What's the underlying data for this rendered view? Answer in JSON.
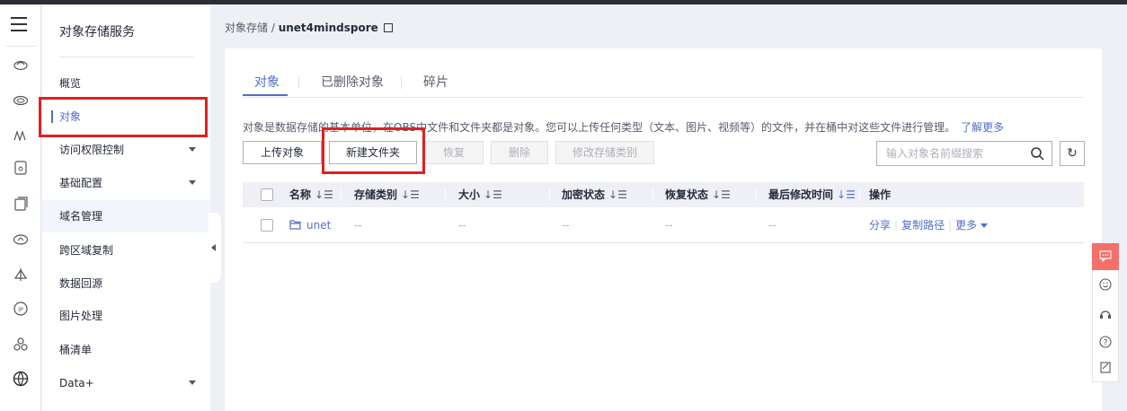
{
  "sidebar": {
    "title": "对象存储服务",
    "items": [
      {
        "label": "概览"
      },
      {
        "label": "对象"
      },
      {
        "label": "访问权限控制"
      },
      {
        "label": "基础配置"
      },
      {
        "label": "域名管理"
      },
      {
        "label": "跨区域复制"
      },
      {
        "label": "数据回源"
      },
      {
        "label": "图片处理"
      },
      {
        "label": "桶清单"
      },
      {
        "label": "Data+"
      }
    ]
  },
  "breadcrumb": {
    "root": "对象存储",
    "separator": " / ",
    "current": "unet4mindspore"
  },
  "tabs": [
    "对象",
    "已删除对象",
    "碎片"
  ],
  "description": {
    "text": "对象是数据存储的基本单位，在OBS中文件和文件夹都是对象。您可以上传任何类型（文本、图片、视频等）的文件，并在桶中对这些文件进行管理。",
    "link": "了解更多"
  },
  "toolbar": {
    "upload": "上传对象",
    "new_folder": "新建文件夹",
    "restore": "恢复",
    "delete": "删除",
    "change_storage": "修改存储类别"
  },
  "search": {
    "placeholder": "输入对象名前缀搜索"
  },
  "table": {
    "columns": [
      "名称",
      "存储类别",
      "大小",
      "加密状态",
      "恢复状态",
      "最后修改时间",
      "操作"
    ],
    "sort_glyph": "↓☰",
    "rows": [
      {
        "name": "unet",
        "storage": "--",
        "size": "--",
        "encryption": "--",
        "restore": "--",
        "modified": "--",
        "ops": {
          "share": "分享",
          "copy_path": "复制路径",
          "more": "更多"
        }
      }
    ]
  },
  "colors": {
    "accent": "#526ecc",
    "highlight": "#e02020",
    "float_chat": "#f66f6a"
  }
}
